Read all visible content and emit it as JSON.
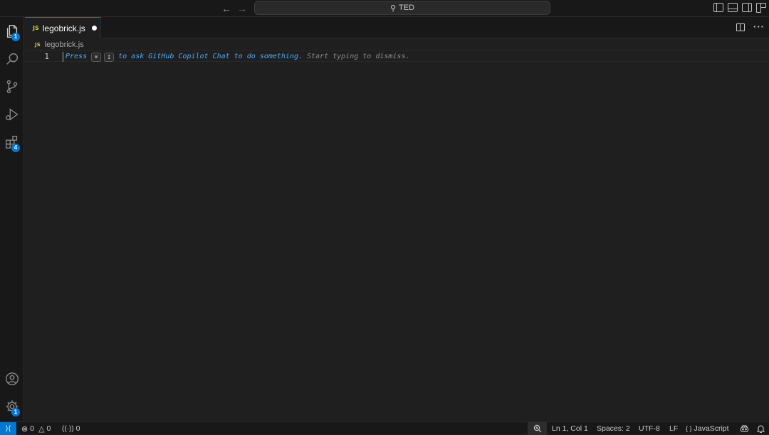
{
  "titlebar": {
    "back_icon": "arrow-left-icon",
    "forward_icon": "arrow-right-icon",
    "search_label": "TED"
  },
  "activitybar": {
    "items": [
      {
        "icon": "explorer-icon",
        "badge": "1"
      },
      {
        "icon": "search-icon",
        "badge": ""
      },
      {
        "icon": "source-control-icon",
        "badge": ""
      },
      {
        "icon": "run-debug-icon",
        "badge": ""
      },
      {
        "icon": "extensions-icon",
        "badge": "4"
      }
    ],
    "bottom": [
      {
        "icon": "account-icon",
        "badge": ""
      },
      {
        "icon": "gear-icon",
        "badge": "1"
      }
    ]
  },
  "tabs": [
    {
      "label": "legobrick.js",
      "type_badge": "JS",
      "dirty": true
    }
  ],
  "breadcrumb": {
    "type_badge": "JS",
    "file": "legobrick.js"
  },
  "editor": {
    "line_number": "1",
    "hint_press": "Press",
    "hint_key1": "⌘",
    "hint_key2": "I",
    "hint_ask": "to ask GitHub Copilot Chat to do something.",
    "hint_dismiss": "Start typing to dismiss."
  },
  "statusbar": {
    "errors": "0",
    "warnings": "0",
    "ports": "0",
    "position": "Ln 1, Col 1",
    "spaces": "Spaces: 2",
    "encoding": "UTF-8",
    "eol": "LF",
    "language_glyph": "{ }",
    "language": "JavaScript"
  },
  "colors": {
    "accent": "#0078d4",
    "hint_blue": "#4daafc",
    "js_yellow": "#cbcb41"
  }
}
